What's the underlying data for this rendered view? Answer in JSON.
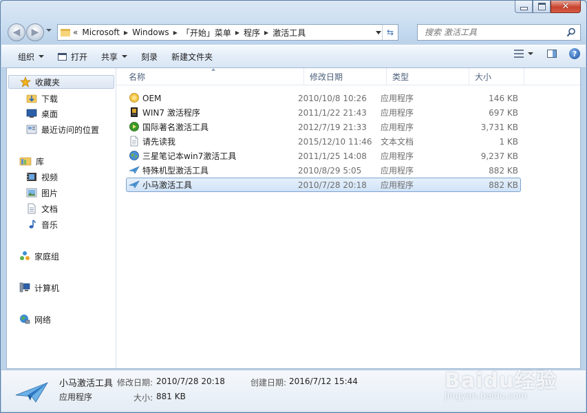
{
  "address": {
    "lead": "«",
    "crumbs": [
      "Microsoft",
      "Windows",
      "「开始」菜单",
      "程序",
      "激活工具"
    ],
    "search_placeholder": "搜索 激活工具"
  },
  "toolbar": {
    "organize": "组织",
    "open": "打开",
    "share": "共享",
    "burn": "刻录",
    "new_folder": "新建文件夹"
  },
  "nav": {
    "favorites": "收藏夹",
    "downloads": "下载",
    "desktop": "桌面",
    "recent": "最近访问的位置",
    "libraries": "库",
    "videos": "视频",
    "pictures": "图片",
    "documents": "文档",
    "music": "音乐",
    "homegroup": "家庭组",
    "computer": "计算机",
    "network": "网络"
  },
  "columns": {
    "name": "名称",
    "modified": "修改日期",
    "type": "类型",
    "size": "大小"
  },
  "files": [
    {
      "name": "OEM",
      "modified": "2010/10/8 10:26",
      "type": "应用程序",
      "size": "146 KB",
      "icon": "oem-app-icon"
    },
    {
      "name": "WIN7 激活程序",
      "modified": "2011/1/22 21:43",
      "type": "应用程序",
      "size": "697 KB",
      "icon": "win7-activator-icon"
    },
    {
      "name": "国际著名激活工具",
      "modified": "2012/7/19 21:33",
      "type": "应用程序",
      "size": "3,731 KB",
      "icon": "green-orb-app-icon"
    },
    {
      "name": "请先读我",
      "modified": "2015/12/10 11:46",
      "type": "文本文档",
      "size": "1 KB",
      "icon": "text-document-icon"
    },
    {
      "name": "三星笔记本win7激活工具",
      "modified": "2011/1/25 14:08",
      "type": "应用程序",
      "size": "9,237 KB",
      "icon": "globe-app-icon"
    },
    {
      "name": "特殊机型激活工具",
      "modified": "2010/8/29 5:05",
      "type": "应用程序",
      "size": "882 KB",
      "icon": "paper-plane-icon"
    },
    {
      "name": "小马激活工具",
      "modified": "2010/7/28 20:18",
      "type": "应用程序",
      "size": "882 KB",
      "icon": "paper-plane-icon"
    }
  ],
  "selected_index": 6,
  "details": {
    "name": "小马激活工具",
    "type": "应用程序",
    "modified_label": "修改日期:",
    "modified_value": "2010/7/28 20:18",
    "created_label": "创建日期:",
    "created_value": "2016/7/12 15:44",
    "size_label": "大小:",
    "size_value": "881 KB"
  },
  "watermark": {
    "logo": "Baidu经验",
    "url": "jingyan.baidu.com"
  },
  "colors": {
    "selection_border": "#7da2ce",
    "close_button": "#c8442e",
    "accent_blue": "#1b4f9c"
  }
}
